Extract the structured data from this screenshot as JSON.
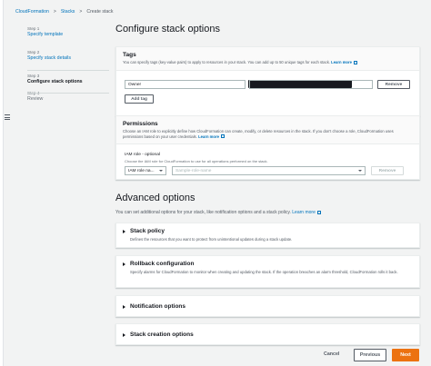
{
  "breadcrumb": {
    "items": [
      "CloudFormation",
      "Stacks",
      "Create stack"
    ],
    "sep": ">"
  },
  "steps": [
    {
      "num": "Step 1",
      "label": "Specify template"
    },
    {
      "num": "Step 2",
      "label": "Specify stack details"
    },
    {
      "num": "Step 3",
      "label": "Configure stack options"
    },
    {
      "num": "Step 4",
      "label": "Review"
    }
  ],
  "page_title": "Configure stack options",
  "tags": {
    "title": "Tags",
    "desc": "You can specify tags (key-value pairs) to apply to resources in your stack. You can add up to 50 unique tags for each stack.",
    "learn_more": "Learn more",
    "key_value": "Owner",
    "remove_label": "Remove",
    "add_label": "Add tag"
  },
  "permissions": {
    "title": "Permissions",
    "desc": "Choose an IAM role to explicitly define how CloudFormation can create, modify, or delete resources in the stack. If you don't choose a role, CloudFormation uses permissions based on your user credentials.",
    "learn_more": "Learn more",
    "role_label": "IAM role - optional",
    "role_hint": "Choose the IAM role for CloudFormation to use for all operations performed on the stack.",
    "select_value": "IAM role na...",
    "role_placeholder": "Sample-role-name",
    "remove_label": "Remove"
  },
  "advanced": {
    "title": "Advanced options",
    "desc": "You can set additional options for your stack, like notification options and a stack policy.",
    "learn_more": "Learn more",
    "sections": [
      {
        "title": "Stack policy",
        "desc": "Defines the resources that you want to protect from unintentional updates during a stack update."
      },
      {
        "title": "Rollback configuration",
        "desc": "Specify alarms for CloudFormation to monitor when creating and updating the stack. If the operation breaches an alarm threshold, CloudFormation rolls it back."
      },
      {
        "title": "Notification options",
        "desc": ""
      },
      {
        "title": "Stack creation options",
        "desc": ""
      }
    ]
  },
  "footer": {
    "cancel": "Cancel",
    "previous": "Previous",
    "next": "Next"
  },
  "colors": {
    "link": "#0073bb",
    "primary": "#ec7211",
    "bg": "#f2f3f3"
  }
}
